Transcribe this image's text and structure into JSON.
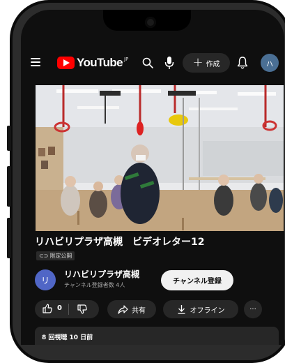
{
  "header": {
    "logo_text": "YouTube",
    "country_code": "JP",
    "create_label": "作成",
    "account_initial": "ハ"
  },
  "video": {
    "title": "リハビリプラザ高槻　ビデオレター12",
    "visibility": "限定公開",
    "views_and_date": "8 回視聴  10 日前"
  },
  "channel": {
    "initial": "リ",
    "name": "リハビリプラザ高槻",
    "subscribers": "チャンネル登録者数 4人",
    "subscribe_label": "チャンネル登録"
  },
  "actions": {
    "like_count": "0",
    "share_label": "共有",
    "offline_label": "オフライン",
    "more_label": "···"
  },
  "colors": {
    "background": "#0f0f0f",
    "chip": "#272727",
    "brand_red": "#ff0000",
    "channel_avatar": "#5066c6",
    "account_avatar": "#4a6f94"
  }
}
